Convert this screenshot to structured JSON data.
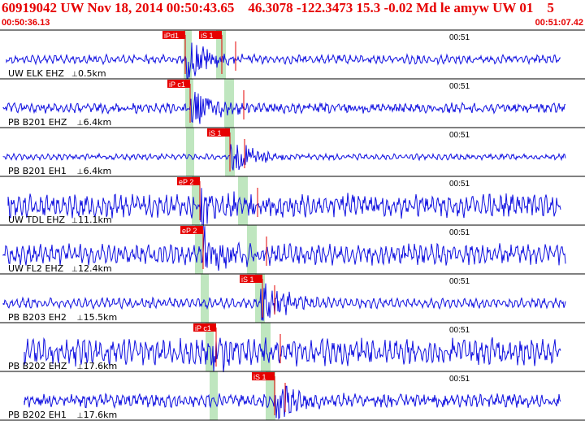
{
  "header": {
    "title": "60919042 UW Nov 18, 2014 00:50:43.65    46.3078 -122.3473 15.3 -0.02 Md le amyw UW 01    5",
    "start_time": "00:50:36.13",
    "end_time": "00:51:07.42"
  },
  "colors": {
    "trace": "#1010e0",
    "pick": "#e60000",
    "window": "#bfe6bf",
    "grid": "#000000"
  },
  "minute_mark": "00:51",
  "traces": [
    {
      "label": "UW ELK EHZ",
      "dist": "0.5km",
      "picks": [
        {
          "text": "iPd1"
        },
        {
          "text": "iS 1"
        }
      ]
    },
    {
      "label": "PB B201 EHZ",
      "dist": "6.4km",
      "picks": [
        {
          "text": "iP c1"
        }
      ]
    },
    {
      "label": "PB B201 EH1",
      "dist": "6.4km",
      "picks": [
        {
          "text": "iS 1"
        }
      ]
    },
    {
      "label": "UW TDL EHZ",
      "dist": "11.1km",
      "picks": [
        {
          "text": "eP 2"
        }
      ]
    },
    {
      "label": "UW FL2 EHZ",
      "dist": "12.4km",
      "picks": [
        {
          "text": "eP 2"
        }
      ]
    },
    {
      "label": "PB B203 EH2",
      "dist": "15.5km",
      "picks": [
        {
          "text": "iS 1"
        }
      ]
    },
    {
      "label": "PB B202 EHZ",
      "dist": "17.6km",
      "picks": [
        {
          "text": "iP c1"
        }
      ]
    },
    {
      "label": "PB B202 EH1",
      "dist": "17.6km",
      "picks": [
        {
          "text": "iS 1"
        }
      ]
    }
  ]
}
